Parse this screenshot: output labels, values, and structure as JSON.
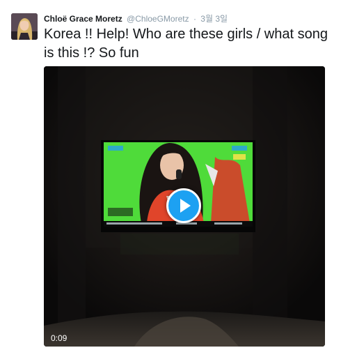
{
  "tweet": {
    "display_name": "Chloë Grace Moretz",
    "screen_name": "@ChloeGMoretz",
    "separator": "·",
    "timestamp": "3월 3일",
    "text": "Korea !! Help! Who are these girls / what song is this !? So fun"
  },
  "media": {
    "type": "video",
    "duration": "0:09",
    "play_icon": "play-icon"
  },
  "colors": {
    "accent": "#1da1f2",
    "name": "#14171a",
    "meta": "#8899a6"
  }
}
